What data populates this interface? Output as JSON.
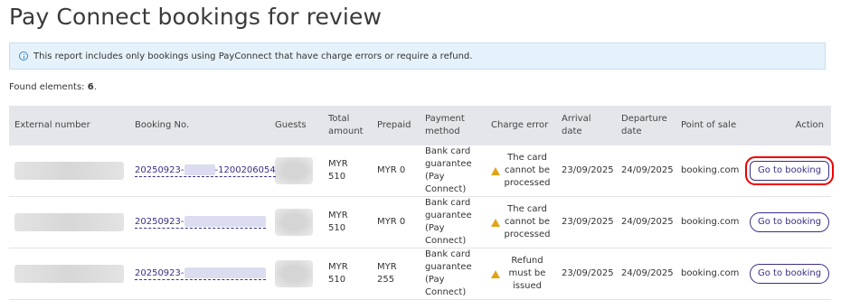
{
  "page": {
    "title": "Pay Connect bookings for review",
    "info": "This report includes only bookings using PayConnect that have charge errors or require a refund.",
    "found_label": "Found elements: ",
    "found_count": "6",
    "found_suffix": "."
  },
  "table": {
    "headers": {
      "external": "External number",
      "booking": "Booking No.",
      "guests": "Guests",
      "total": "Total amount",
      "prepaid": "Prepaid",
      "payment": "Payment method",
      "charge": "Charge error",
      "arrival": "Arrival date",
      "departure": "Departure date",
      "pos": "Point of sale",
      "action": "Action"
    },
    "rows": [
      {
        "booking_prefix": "20250923-",
        "booking_suffix": "-1200206054",
        "total": "MYR 510",
        "prepaid": "MYR 0",
        "payment": "Bank card guarantee (Pay Connect)",
        "charge": "The card cannot be processed",
        "arrival": "23/09/2025",
        "departure": "24/09/2025",
        "pos": "booking.com",
        "action": "Go to booking"
      },
      {
        "booking_prefix": "20250923-",
        "booking_suffix": "",
        "total": "MYR 510",
        "prepaid": "MYR 0",
        "payment": "Bank card guarantee (Pay Connect)",
        "charge": "The card cannot be processed",
        "arrival": "23/09/2025",
        "departure": "24/09/2025",
        "pos": "booking.com",
        "action": "Go to booking"
      },
      {
        "booking_prefix": "20250923-",
        "booking_suffix": "",
        "total": "MYR 510",
        "prepaid": "MYR 255",
        "payment": "Bank card guarantee (Pay Connect)",
        "charge": "Refund must be issued",
        "arrival": "23/09/2025",
        "departure": "24/09/2025",
        "pos": "booking.com",
        "action": "Go to booking"
      }
    ]
  },
  "colors": {
    "link": "#3a2e86",
    "warning": "#e0a419",
    "info_bg": "#e6f2fb",
    "header_bg": "#e4e6ea",
    "highlight": "#e00000"
  }
}
